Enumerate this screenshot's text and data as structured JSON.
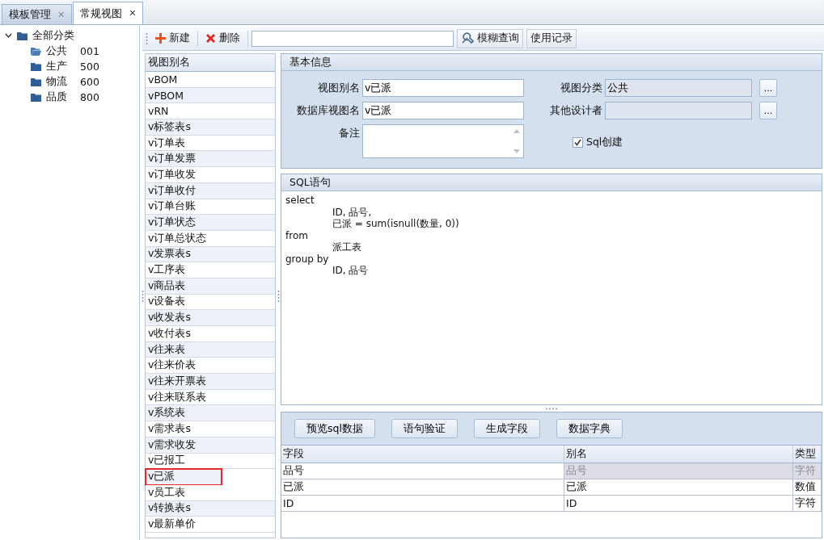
{
  "tabs": [
    {
      "label": "模板管理",
      "close": "✕",
      "selected": false
    },
    {
      "label": "常规视图",
      "close": "✕",
      "selected": true
    }
  ],
  "tree": {
    "label": "全部分类",
    "expanded": true,
    "children": [
      {
        "label": "公共",
        "code": "001",
        "selected": true
      },
      {
        "label": "生产",
        "code": "500",
        "selected": false
      },
      {
        "label": "物流",
        "code": "600",
        "selected": false
      },
      {
        "label": "品质",
        "code": "800",
        "selected": false
      }
    ]
  },
  "toolbar": {
    "new_button": "新建",
    "delete_button": "删除",
    "search_button": "模糊查询",
    "history_button": "使用记录"
  },
  "view_list": {
    "header": "视图别名",
    "items": [
      {
        "label": "vBOM",
        "marked": false
      },
      {
        "label": "vPBOM",
        "marked": false
      },
      {
        "label": "vRN",
        "marked": false
      },
      {
        "label": "v标签表s",
        "marked": false
      },
      {
        "label": "v订单表",
        "marked": false
      },
      {
        "label": "v订单发票",
        "marked": false
      },
      {
        "label": "v订单收发",
        "marked": false
      },
      {
        "label": "v订单收付",
        "marked": false
      },
      {
        "label": "v订单台账",
        "marked": false
      },
      {
        "label": "v订单状态",
        "marked": false
      },
      {
        "label": "v订单总状态",
        "marked": false
      },
      {
        "label": "v发票表s",
        "marked": false
      },
      {
        "label": "v工序表",
        "marked": false
      },
      {
        "label": "v商品表",
        "marked": false
      },
      {
        "label": "v设备表",
        "marked": false
      },
      {
        "label": "v收发表s",
        "marked": false
      },
      {
        "label": "v收付表s",
        "marked": false
      },
      {
        "label": "v往来表",
        "marked": false
      },
      {
        "label": "v往来价表",
        "marked": false
      },
      {
        "label": "v往来开票表",
        "marked": false
      },
      {
        "label": "v往来联系表",
        "marked": false
      },
      {
        "label": "v系统表",
        "marked": false
      },
      {
        "label": "v需求表s",
        "marked": false
      },
      {
        "label": "v需求收发",
        "marked": false
      },
      {
        "label": "v已报工",
        "marked": false
      },
      {
        "label": "v已派",
        "marked": true
      },
      {
        "label": "v员工表",
        "marked": false
      },
      {
        "label": "v转换表s",
        "marked": false
      },
      {
        "label": "v最新单价",
        "marked": false
      }
    ]
  },
  "basic_info": {
    "title": "基本信息",
    "alias_label": "视图别名",
    "alias_value": "v已派",
    "db_name_label": "数据库视图名",
    "db_name_value": "v已派",
    "remark_label": "备注",
    "category_label": "视图分类",
    "category_value": "公共",
    "category_button": "...",
    "designer_label": "其他设计者",
    "designer_button": "...",
    "sql_create": {
      "label": "Sql创建",
      "checked": true
    }
  },
  "sql": {
    "title": "SQL语句",
    "lines": [
      {
        "text": "select",
        "kind": "keyword"
      },
      {
        "text": "ID, 品号,",
        "kind": "body"
      },
      {
        "text": "已派 = sum(isnull(数量, 0))",
        "kind": "body"
      },
      {
        "text": "from",
        "kind": "keyword"
      },
      {
        "text": "派工表",
        "kind": "body"
      },
      {
        "text": "group by",
        "kind": "keyword"
      },
      {
        "text": "ID, 品号",
        "kind": "body"
      }
    ]
  },
  "actions": [
    "预览sql数据",
    "语句验证",
    "生成字段",
    "数据字典"
  ],
  "fields_table": {
    "columns": [
      "字段",
      "别名",
      "类型"
    ],
    "rows": [
      {
        "cells": [
          "品号",
          "品号",
          "字符"
        ],
        "disabled": true
      },
      {
        "cells": [
          "已派",
          "已派",
          "数值"
        ],
        "disabled": false
      },
      {
        "cells": [
          "ID",
          "ID",
          "字符"
        ],
        "disabled": false
      }
    ]
  }
}
